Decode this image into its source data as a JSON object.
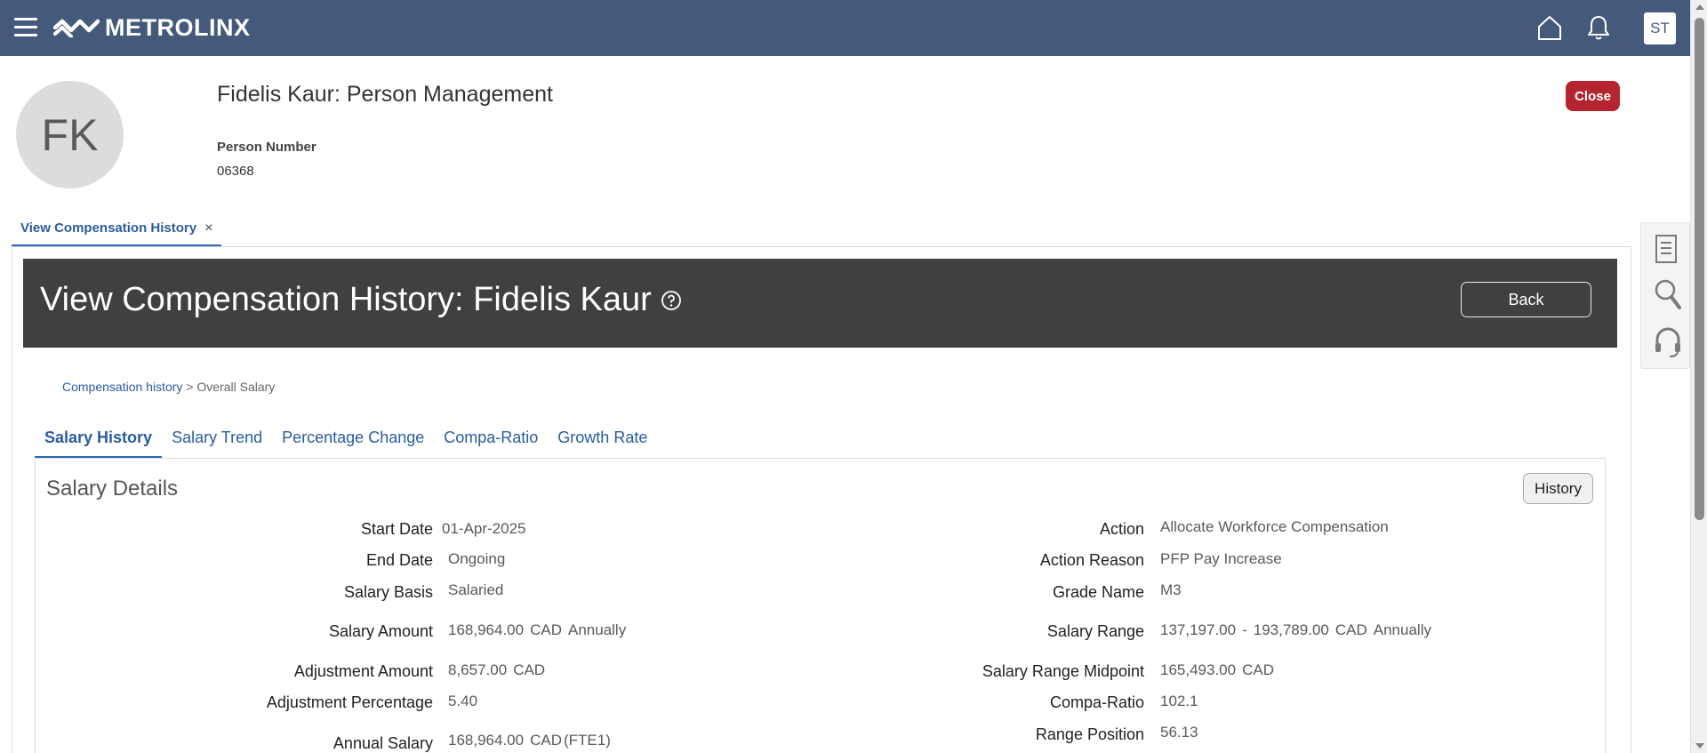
{
  "topbar": {
    "brand": "METROLINX",
    "user_initials": "ST"
  },
  "person": {
    "initials": "FK",
    "page_title": "Fidelis Kaur: Person Management",
    "number_label": "Person Number",
    "number_value": "06368",
    "close_label": "Close"
  },
  "open_tab": {
    "label": "View Compensation History",
    "close_glyph": "×"
  },
  "header": {
    "title": "View Compensation History: Fidelis Kaur",
    "back_label": "Back"
  },
  "breadcrumb": {
    "link": "Compensation history",
    "separator": " > ",
    "current": "Overall Salary"
  },
  "subtabs": [
    "Salary History",
    "Salary Trend",
    "Percentage Change",
    "Compa-Ratio",
    "Growth Rate"
  ],
  "details": {
    "title": "Salary Details",
    "history_label": "History",
    "left": {
      "start_date_label": "Start Date",
      "start_date": "01-Apr-2025",
      "end_date_label": "End Date",
      "end_date": "Ongoing",
      "salary_basis_label": "Salary Basis",
      "salary_basis": "Salaried",
      "salary_amount_label": "Salary Amount",
      "salary_amount": "168,964.00",
      "salary_amount_currency": "CAD",
      "salary_amount_freq": "Annually",
      "adjustment_amount_label": "Adjustment Amount",
      "adjustment_amount": "8,657.00",
      "adjustment_amount_currency": "CAD",
      "adjustment_pct_label": "Adjustment Percentage",
      "adjustment_pct": "5.40",
      "annual_salary_label": "Annual Salary",
      "annual_salary": "168,964.00",
      "annual_salary_currency": "CAD",
      "annual_salary_fte": "(FTE1)"
    },
    "right": {
      "action_label": "Action",
      "action": "Allocate Workforce Compensation",
      "action_reason_label": "Action Reason",
      "action_reason": "PFP Pay Increase",
      "grade_name_label": "Grade Name",
      "grade_name": "M3",
      "salary_range_label": "Salary Range",
      "salary_range_min": "137,197.00",
      "salary_range_sep": "-",
      "salary_range_max": "193,789.00",
      "salary_range_currency": "CAD",
      "salary_range_freq": "Annually",
      "midpoint_label": "Salary Range Midpoint",
      "midpoint": "165,493.00",
      "midpoint_currency": "CAD",
      "compa_ratio_label": "Compa-Ratio",
      "compa_ratio": "102.1",
      "range_position_label": "Range Position",
      "range_position": "56.13"
    }
  },
  "colors": {
    "topbar": "#455a7a",
    "dark_header": "#404040",
    "close_button": "#b5252f",
    "link": "#2b5c9e"
  }
}
